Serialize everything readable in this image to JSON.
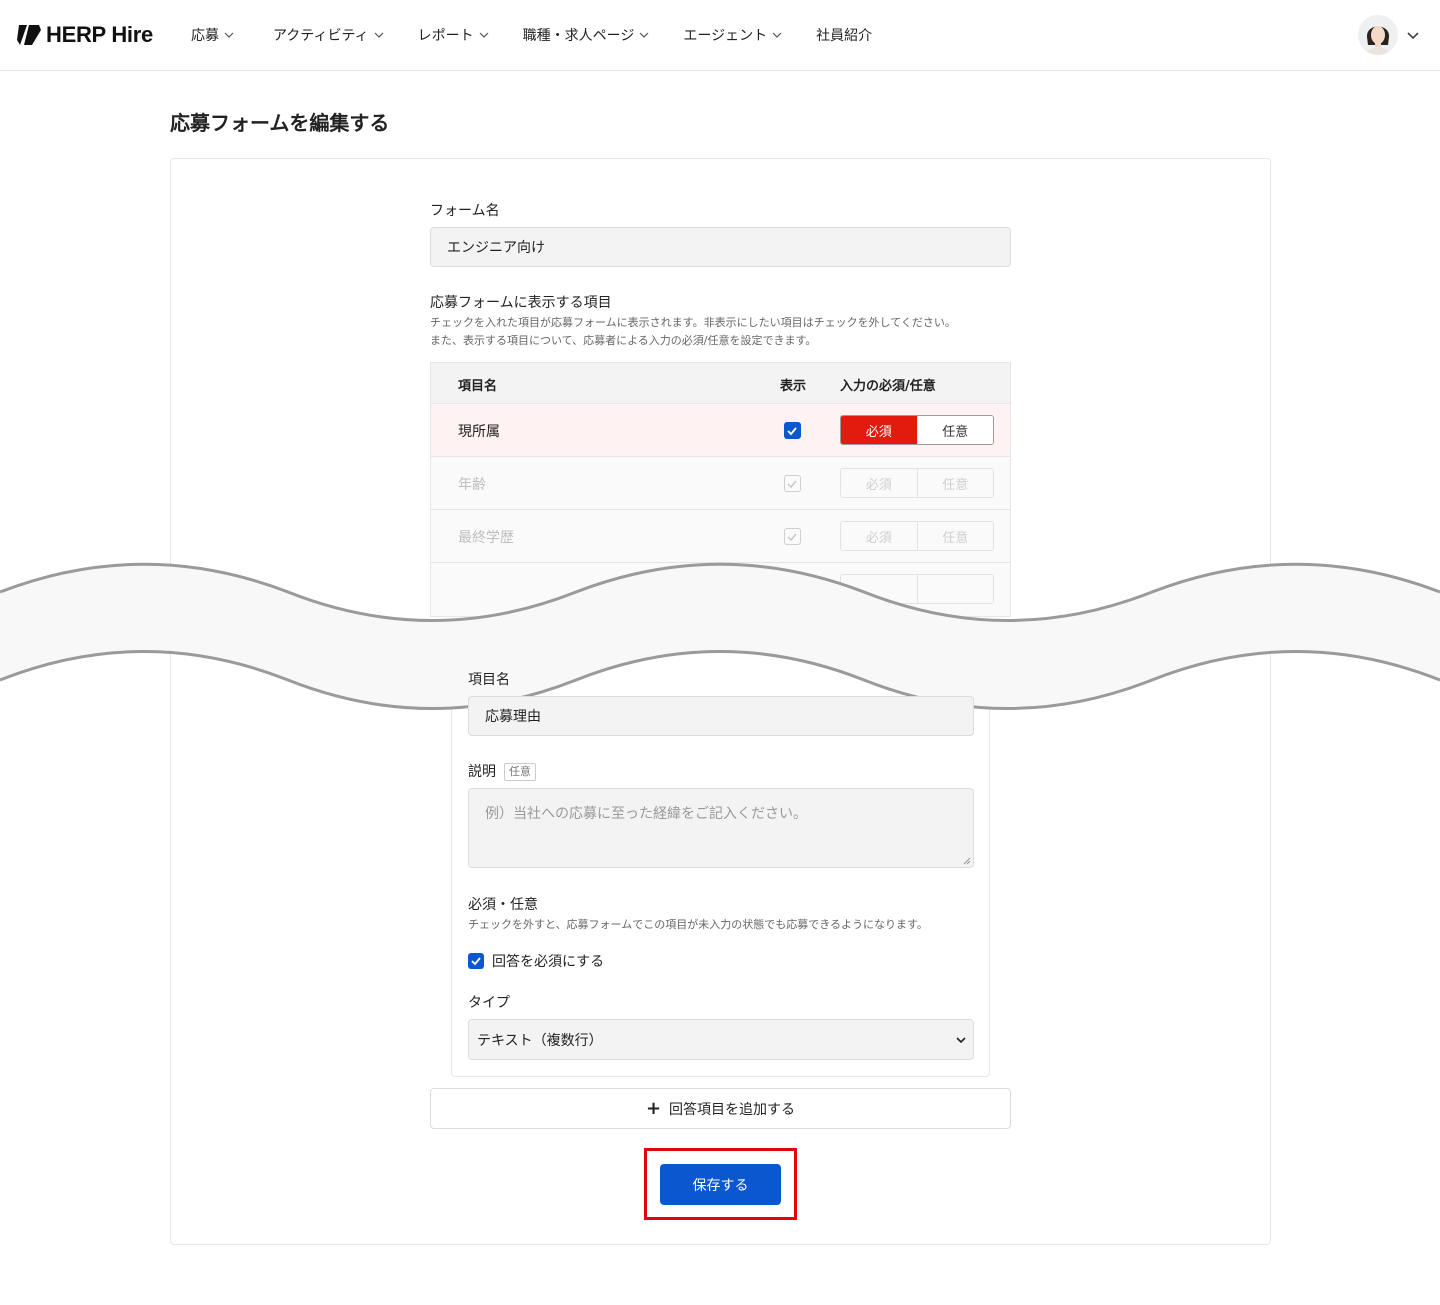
{
  "header": {
    "brand": "HERP Hire",
    "nav": [
      {
        "label": "応募",
        "has_dropdown": true
      },
      {
        "label": "アクティビティ",
        "has_dropdown": true
      },
      {
        "label": "レポート",
        "has_dropdown": true
      },
      {
        "label": "職種・求人ページ",
        "has_dropdown": true
      },
      {
        "label": "エージェント",
        "has_dropdown": true
      },
      {
        "label": "社員紹介",
        "has_dropdown": false
      }
    ]
  },
  "page": {
    "title": "応募フォームを編集する"
  },
  "form": {
    "name_label": "フォーム名",
    "name_value": "エンジニア向け",
    "items_label": "応募フォームに表示する項目",
    "items_help_1": "チェックを入れた項目が応募フォームに表示されます。非表示にしたい項目はチェックを外してください。",
    "items_help_2": "また、表示する項目について、応募者による入力の必須/任意を設定できます。",
    "table": {
      "col_name": "項目名",
      "col_show": "表示",
      "col_required": "入力の必須/任意",
      "required_label": "必須",
      "optional_label": "任意",
      "rows": [
        {
          "name": "現所属",
          "shown": true,
          "required": true,
          "active": true
        },
        {
          "name": "年齢",
          "shown": true,
          "required": false,
          "active": false
        },
        {
          "name": "最終学歴",
          "shown": true,
          "required": false,
          "active": false
        }
      ]
    }
  },
  "question": {
    "item_name_label": "項目名",
    "item_name_value": "応募理由",
    "description_label": "説明",
    "description_tag": "任意",
    "description_placeholder": "例）当社への応募に至った経緯をご記入ください。",
    "required_label": "必須・任意",
    "required_help": "チェックを外すと、応募フォームでこの項目が未入力の状態でも応募できるようになります。",
    "required_checkbox_label": "回答を必須にする",
    "required_checked": true,
    "type_label": "タイプ",
    "type_value": "テキスト（複数行）"
  },
  "actions": {
    "add_item": "回答項目を追加する",
    "save": "保存する"
  },
  "colors": {
    "primary": "#0a57d0",
    "required_red": "#e21b0e",
    "highlight_red": "#e0060b",
    "active_row": "#fff2f2"
  }
}
